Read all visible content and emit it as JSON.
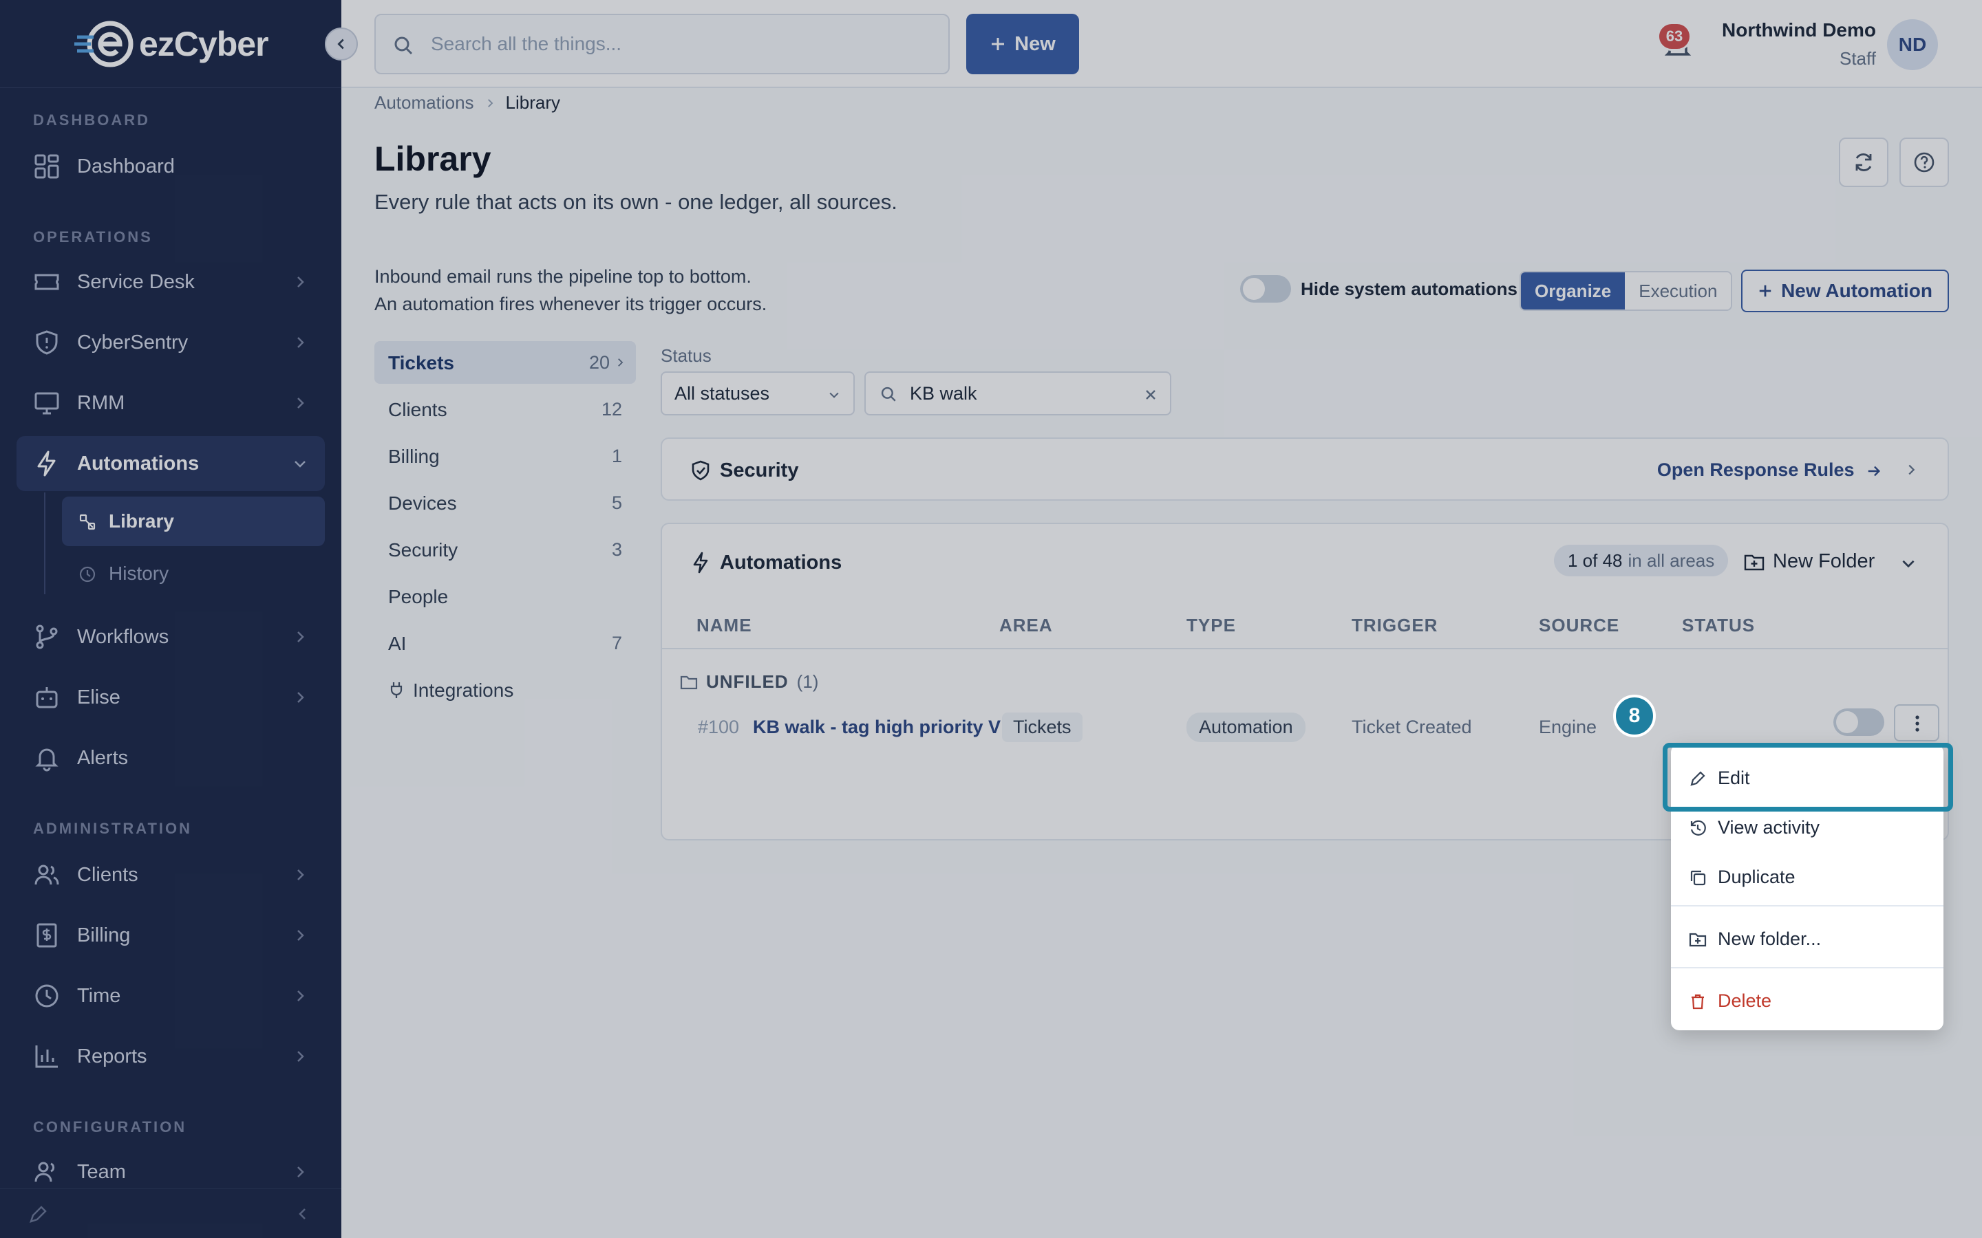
{
  "app": {
    "name": "ezCyber"
  },
  "sidebar": {
    "sections": {
      "dashboard": "DASHBOARD",
      "operations": "OPERATIONS",
      "administration": "ADMINISTRATION",
      "configuration": "CONFIGURATION"
    },
    "items": {
      "dashboard": "Dashboard",
      "service_desk": "Service Desk",
      "cybersentry": "CyberSentry",
      "rmm": "RMM",
      "automations": "Automations",
      "library": "Library",
      "history": "History",
      "workflows": "Workflows",
      "elise": "Elise",
      "alerts": "Alerts",
      "clients": "Clients",
      "billing": "Billing",
      "time": "Time",
      "reports": "Reports",
      "team": "Team"
    }
  },
  "topbar": {
    "search_placeholder": "Search all the things...",
    "new_label": "New",
    "notification_count": "63",
    "user_name": "Northwind Demo",
    "user_role": "Staff",
    "avatar_initials": "ND"
  },
  "breadcrumb": {
    "parent": "Automations",
    "current": "Library"
  },
  "page": {
    "title": "Library",
    "subtitle": "Every rule that acts on its own - one ledger, all sources.",
    "info_line1": "Inbound email runs the pipeline top to bottom.",
    "info_line2": "An automation fires whenever its trigger occurs.",
    "hide_system_label": "Hide system automations",
    "organize_label": "Organize",
    "execution_label": "Execution",
    "new_automation_label": "New Automation"
  },
  "categories": [
    {
      "label": "Tickets",
      "count": "20"
    },
    {
      "label": "Clients",
      "count": "12"
    },
    {
      "label": "Billing",
      "count": "1"
    },
    {
      "label": "Devices",
      "count": "5"
    },
    {
      "label": "Security",
      "count": "3"
    },
    {
      "label": "People",
      "count": ""
    },
    {
      "label": "AI",
      "count": "7"
    },
    {
      "label": "Integrations",
      "count": ""
    }
  ],
  "filters": {
    "status_label": "Status",
    "status_value": "All statuses",
    "search_value": "KB walk"
  },
  "security_panel": {
    "title": "Security",
    "link": "Open Response Rules"
  },
  "automations_panel": {
    "title": "Automations",
    "count_main": "1 of 48",
    "count_suffix": "in all areas",
    "new_folder_label": "New Folder",
    "columns": [
      "NAME",
      "AREA",
      "TYPE",
      "TRIGGER",
      "SOURCE",
      "STATUS"
    ],
    "group_label": "UNFILED",
    "group_count": "(1)",
    "row": {
      "id": "#100",
      "name": "KB walk - tag high priority VI",
      "area": "Tickets",
      "type": "Automation",
      "trigger": "Ticket Created",
      "source": "Engine"
    }
  },
  "context_menu": {
    "edit": "Edit",
    "view_activity": "View activity",
    "duplicate": "Duplicate",
    "new_folder": "New folder...",
    "delete": "Delete"
  },
  "step_badge": "8",
  "colors": {
    "sidebar_bg": "#1e2a4a",
    "accent": "#3a5fa8",
    "highlight": "#1f86a6",
    "danger": "#c0392b"
  }
}
